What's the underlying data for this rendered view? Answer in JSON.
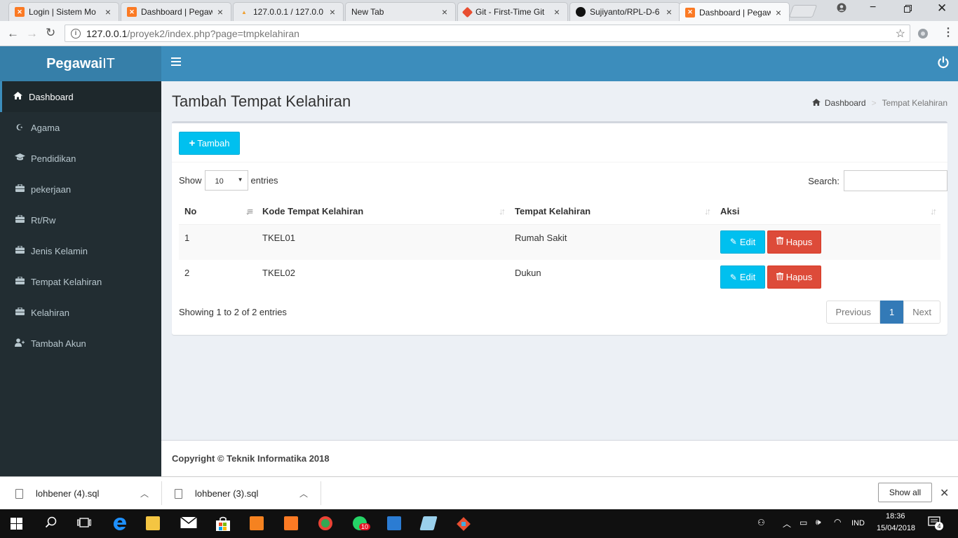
{
  "browser": {
    "tabs": [
      {
        "title": "Login | Sistem Mo",
        "favicon": "xampp-icon"
      },
      {
        "title": "Dashboard | Pegaw",
        "favicon": "xampp-icon"
      },
      {
        "title": "127.0.0.1 / 127.0.0",
        "favicon": "phpmyadmin-icon"
      },
      {
        "title": "New Tab",
        "favicon": ""
      },
      {
        "title": "Git - First-Time Git",
        "favicon": "git-icon"
      },
      {
        "title": "Sujiyanto/RPL-D-6",
        "favicon": "github-icon"
      },
      {
        "title": "Dashboard | Pegaw",
        "favicon": "xampp-icon"
      }
    ],
    "url_host": "127.0.0.1",
    "url_path": "/proyek2/index.php?page=tmpkelahiran"
  },
  "app": {
    "logo_bold": "Pegawai",
    "logo_light": "IT",
    "menu": [
      {
        "label": "Dashboard",
        "icon": "home-icon"
      },
      {
        "label": "Agama",
        "icon": "moon-star-icon"
      },
      {
        "label": "Pendidikan",
        "icon": "graduation-cap-icon"
      },
      {
        "label": "pekerjaan",
        "icon": "briefcase-icon"
      },
      {
        "label": "Rt/Rw",
        "icon": "briefcase-icon"
      },
      {
        "label": "Jenis Kelamin",
        "icon": "briefcase-icon"
      },
      {
        "label": "Tempat Kelahiran",
        "icon": "briefcase-icon"
      },
      {
        "label": "Kelahiran",
        "icon": "briefcase-icon"
      },
      {
        "label": "Tambah Akun",
        "icon": "user-plus-icon"
      }
    ],
    "accent": "#3c8dbc",
    "sidebar_bg": "#222d32"
  },
  "page": {
    "title": "Tambah Tempat Kelahiran",
    "breadcrumb": [
      "Dashboard",
      "Tempat Kelahiran"
    ],
    "add_button": "Tambah",
    "show_label": "Show",
    "entries_value": "10",
    "entries_label": "entries",
    "search_label": "Search:",
    "columns": [
      "No",
      "Kode Tempat Kelahiran",
      "Tempat Kelahiran",
      "Aksi"
    ],
    "rows": [
      {
        "no": "1",
        "kode": "TKEL01",
        "tempat": "Rumah Sakit"
      },
      {
        "no": "2",
        "kode": "TKEL02",
        "tempat": "Dukun"
      }
    ],
    "edit_label": "Edit",
    "delete_label": "Hapus",
    "info": "Showing 1 to 2 of 2 entries",
    "pager": {
      "prev": "Previous",
      "current": "1",
      "next": "Next"
    },
    "footer": "Copyright © Teknik Informatika 2018"
  },
  "downloads": {
    "items": [
      "lohbener (4).sql",
      "lohbener (3).sql"
    ],
    "show_all": "Show all"
  },
  "taskbar": {
    "lang": "IND",
    "time": "18:36",
    "date": "15/04/2018",
    "notifications": "4",
    "whatsapp_badge": "10"
  }
}
